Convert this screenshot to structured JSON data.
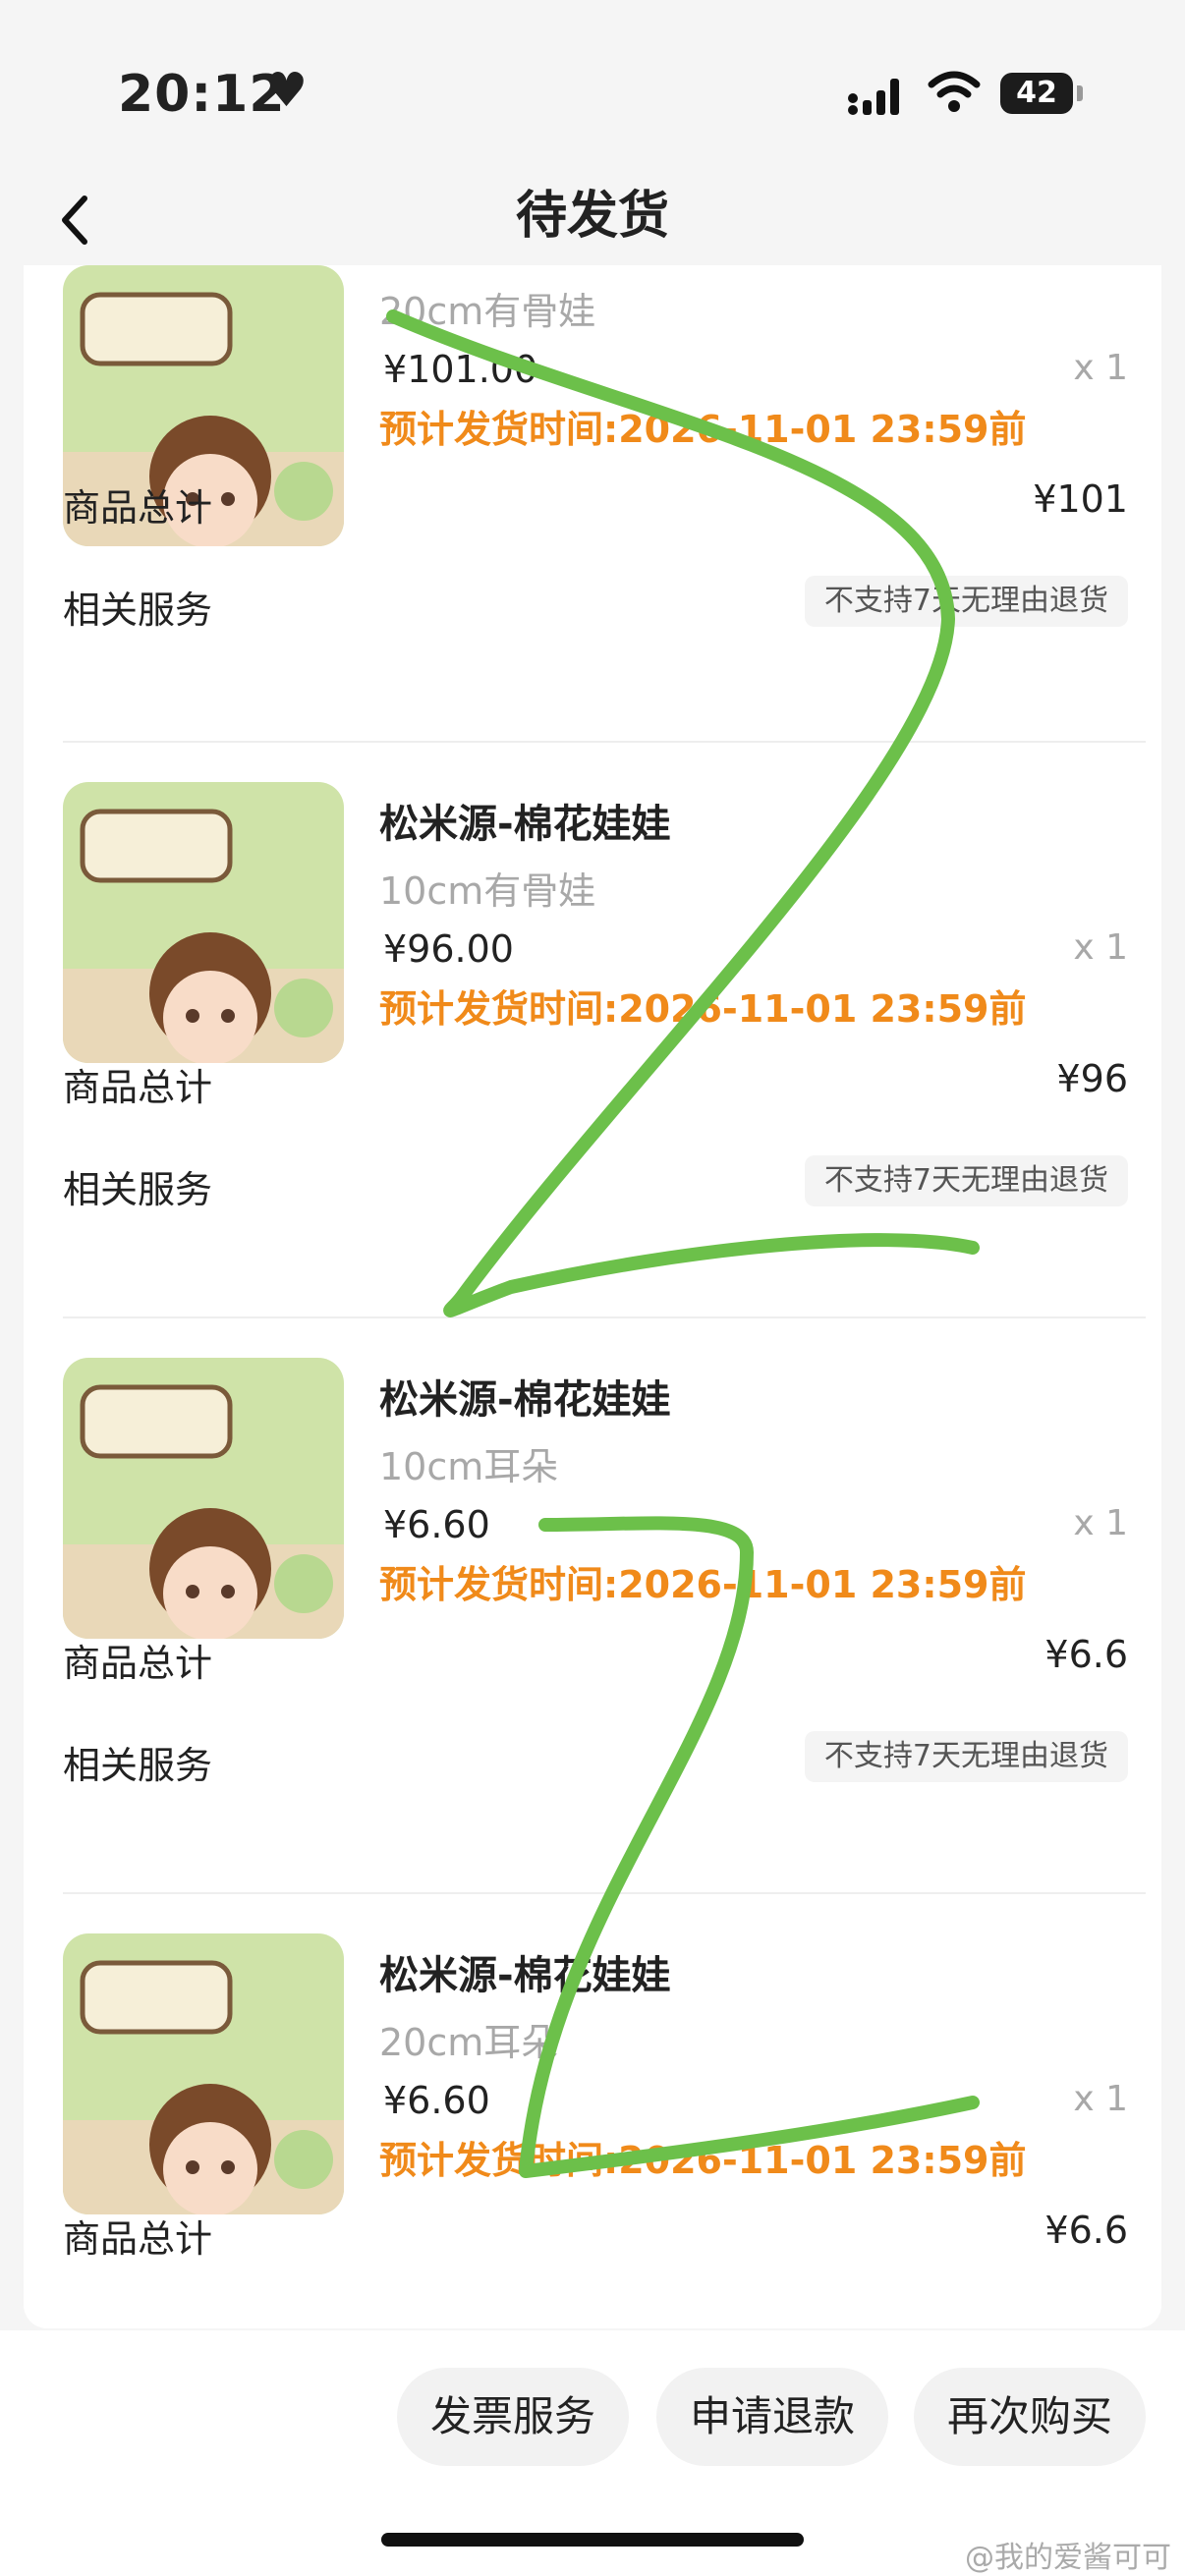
{
  "status_bar": {
    "time": "20:12",
    "battery": "42"
  },
  "header": {
    "title": "待发货",
    "back_icon": "chevron-left-icon"
  },
  "items": [
    {
      "name": "",
      "spec": "20cm有骨娃",
      "price": "¥101.00",
      "qty": "x 1",
      "ship": "预计发货时间:2026-11-01 23:59前",
      "total_label": "商品总计",
      "total": "¥101",
      "service_label": "相关服务",
      "service_tag": "不支持7天无理由退货"
    },
    {
      "name": "松米源-棉花娃娃",
      "spec": "10cm有骨娃",
      "price": "¥96.00",
      "qty": "x 1",
      "ship": "预计发货时间:2026-11-01 23:59前",
      "total_label": "商品总计",
      "total": "¥96",
      "service_label": "相关服务",
      "service_tag": "不支持7天无理由退货"
    },
    {
      "name": "松米源-棉花娃娃",
      "spec": "10cm耳朵",
      "price": "¥6.60",
      "qty": "x 1",
      "ship": "预计发货时间:2026-11-01 23:59前",
      "total_label": "商品总计",
      "total": "¥6.6",
      "service_label": "相关服务",
      "service_tag": "不支持7天无理由退货"
    },
    {
      "name": "松米源-棉花娃娃",
      "spec": "20cm耳朵",
      "price": "¥6.60",
      "qty": "x 1",
      "ship": "预计发货时间:2026-11-01 23:59前",
      "total_label": "商品总计",
      "total": "¥6.6"
    }
  ],
  "actions": {
    "invoice": "发票服务",
    "refund": "申请退款",
    "rebuy": "再次购买"
  },
  "watermark": "@我的爱酱可可",
  "colors": {
    "accent_orange": "#f08a1a",
    "scribble_green": "#6cc04a"
  }
}
